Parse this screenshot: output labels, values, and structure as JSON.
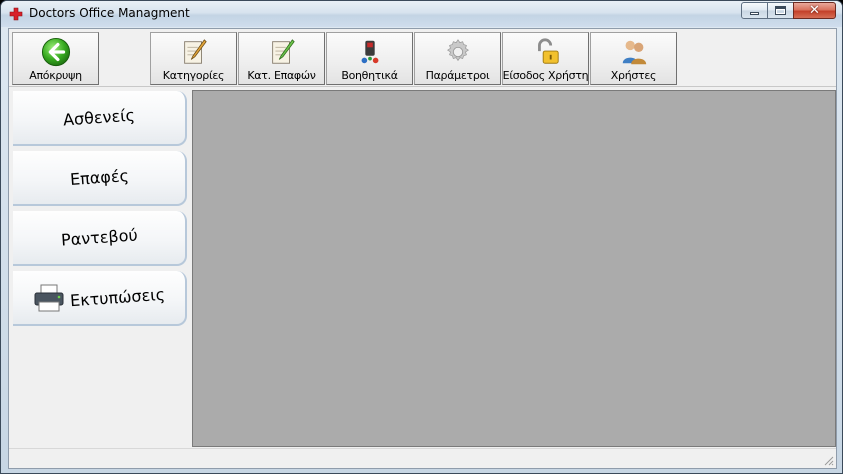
{
  "window": {
    "title": "Doctors Office Managment",
    "close_glyph": "✕"
  },
  "toolbar": {
    "buttons": [
      {
        "label": "Απόκρυψη",
        "icon": "back-arrow-icon"
      },
      {
        "label": "Κατηγορίες",
        "icon": "notepad-pencil-icon"
      },
      {
        "label": "Κατ. Επαφών",
        "icon": "notepad-pencil-green-icon"
      },
      {
        "label": "Βοηθητικά",
        "icon": "tools-icon"
      },
      {
        "label": "Παράμετροι",
        "icon": "gear-icon"
      },
      {
        "label": "Είσοδος Χρήστη",
        "icon": "unlocked-padlock-icon"
      },
      {
        "label": "Χρήστες",
        "icon": "users-icon"
      }
    ]
  },
  "sidebar": {
    "items": [
      {
        "label": "Ασθενείς"
      },
      {
        "label": "Επαφές"
      },
      {
        "label": "Ραντεβού"
      },
      {
        "label": "Εκτυπώσεις",
        "icon": "printer-icon"
      }
    ]
  },
  "colors": {
    "mdi_background": "#ababab",
    "accent": "#2e9a1c"
  }
}
